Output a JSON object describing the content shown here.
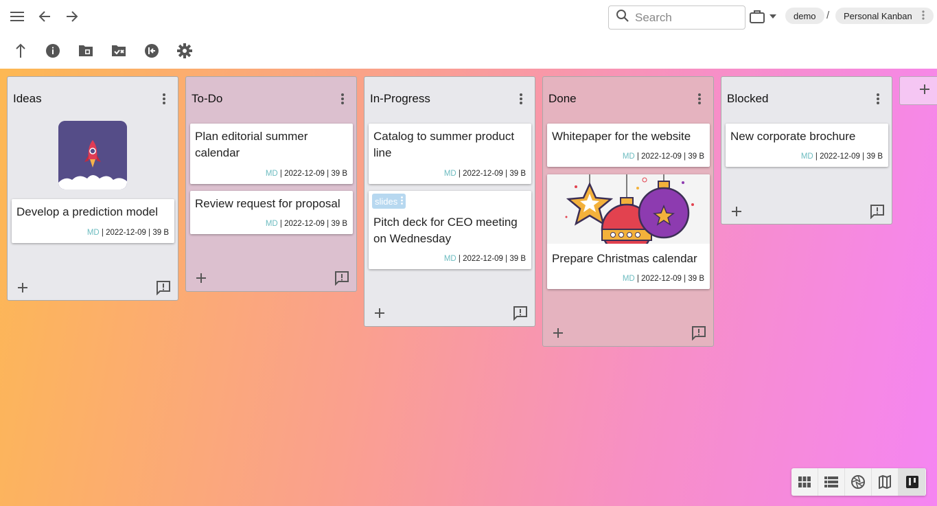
{
  "search": {
    "placeholder": "Search",
    "value": ""
  },
  "breadcrumb": {
    "workspace": "demo",
    "separator": "/",
    "board": "Personal Kanban"
  },
  "colors": {
    "accent": "#6dbcc0",
    "gradient_start": "#fdb853",
    "gradient_end": "#f585f2"
  },
  "columns": [
    {
      "title": "Ideas",
      "cards": [
        {
          "title": "Develop a prediction model",
          "author": "MD",
          "date": "2022-12-09",
          "size": "39 B",
          "image": "rocket"
        }
      ]
    },
    {
      "title": "To-Do",
      "cards": [
        {
          "title": "Plan editorial summer calendar",
          "author": "MD",
          "date": "2022-12-09",
          "size": "39 B"
        },
        {
          "title": "Review request for proposal",
          "author": "MD",
          "date": "2022-12-09",
          "size": "39 B"
        }
      ]
    },
    {
      "title": "In-Progress",
      "cards": [
        {
          "title": "Catalog to summer product line",
          "author": "MD",
          "date": "2022-12-09",
          "size": "39 B"
        },
        {
          "tag": "slides",
          "title": "Pitch deck for CEO meeting on Wednesday",
          "author": "MD",
          "date": "2022-12-09",
          "size": "39 B"
        }
      ]
    },
    {
      "title": "Done",
      "cards": [
        {
          "title": "Whitepaper for the website",
          "author": "MD",
          "date": "2022-12-09",
          "size": "39 B"
        },
        {
          "title": "Prepare Christmas calendar",
          "author": "MD",
          "date": "2022-12-09",
          "size": "39 B",
          "image": "christmas-ornaments"
        }
      ]
    },
    {
      "title": "Blocked",
      "cards": [
        {
          "title": "New corporate brochure",
          "author": "MD",
          "date": "2022-12-09",
          "size": "39 B"
        }
      ]
    }
  ],
  "view_modes": [
    "grid-view",
    "list-view",
    "aperture-view",
    "map-view",
    "kanban-view"
  ],
  "active_view": "kanban-view"
}
